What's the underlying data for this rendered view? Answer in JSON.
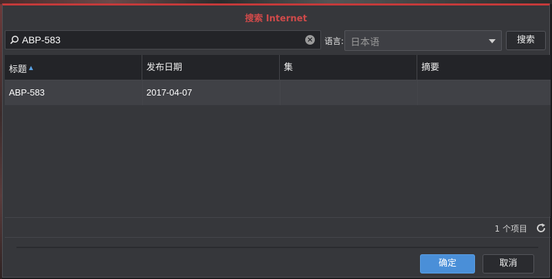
{
  "dialog": {
    "title": "搜索 Internet"
  },
  "search": {
    "value": "ABP-583",
    "clear_icon": "×"
  },
  "language": {
    "label": "语言:",
    "selected": "日本语"
  },
  "buttons": {
    "search": "搜索",
    "ok": "确定",
    "cancel": "取消"
  },
  "table": {
    "columns": [
      "标题",
      "发布日期",
      "集",
      "摘要"
    ],
    "sort_indicator": "▲",
    "rows": [
      {
        "title": "ABP-583",
        "release_date": "2017-04-07",
        "episode": "",
        "summary": ""
      }
    ]
  },
  "footer": {
    "count": "1 个项目"
  },
  "colors": {
    "title": "#d04a4a",
    "accent": "#4a8fd8",
    "sort_arrow": "#5aa3e6"
  }
}
